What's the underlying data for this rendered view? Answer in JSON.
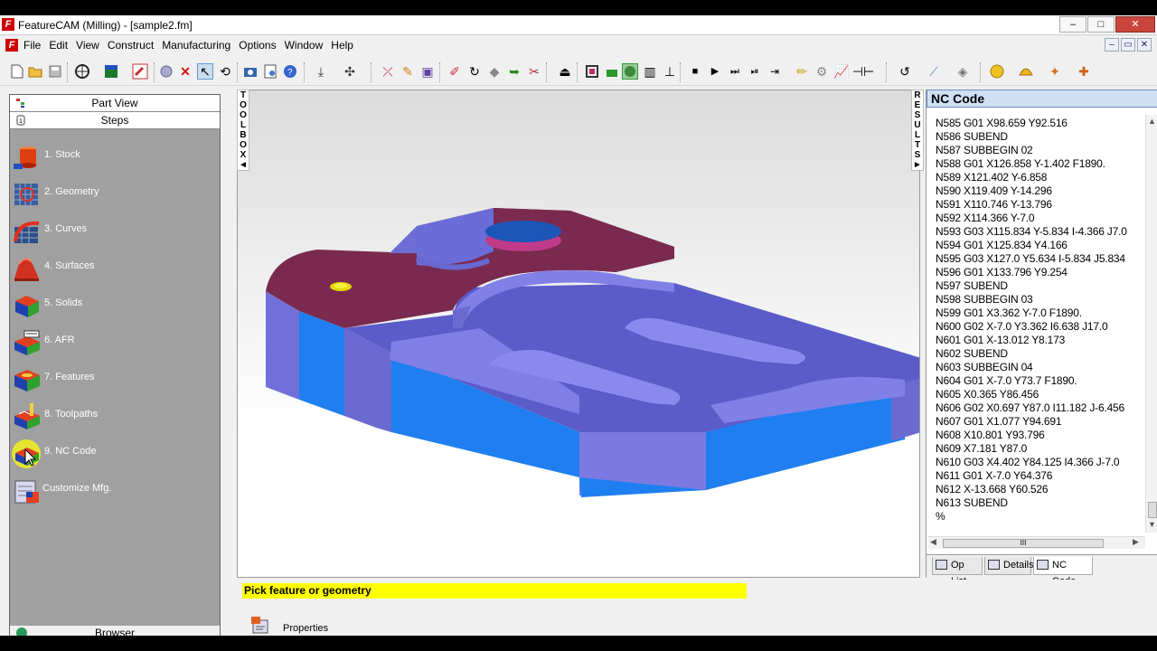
{
  "window": {
    "title": "FeatureCAM (Milling) - [sample2.fm]",
    "app_icon": "F",
    "buttons": [
      "–",
      "□",
      "✕"
    ]
  },
  "menu": {
    "items": [
      "File",
      "Edit",
      "View",
      "Construct",
      "Manufacturing",
      "Options",
      "Window",
      "Help"
    ],
    "mdi_buttons": [
      "–",
      "▭",
      "✕"
    ]
  },
  "left_panel": {
    "part_view": "Part View",
    "steps": "Steps",
    "items": [
      {
        "label": "1.  Stock",
        "icon": "stock-icon"
      },
      {
        "label": "2.  Geometry",
        "icon": "geometry-icon"
      },
      {
        "label": "3.  Curves",
        "icon": "curves-icon"
      },
      {
        "label": "4.  Surfaces",
        "icon": "surfaces-icon"
      },
      {
        "label": "5.  Solids",
        "icon": "solids-icon"
      },
      {
        "label": "6.  AFR",
        "icon": "afr-icon"
      },
      {
        "label": "7.  Features",
        "icon": "features-icon"
      },
      {
        "label": "8.  Toolpaths",
        "icon": "toolpaths-icon"
      },
      {
        "label": "9.  NC Code",
        "icon": "nc-code-icon"
      },
      {
        "label": "Customize Mfg.",
        "icon": "customize-mfg-icon"
      }
    ],
    "browser": "Browser"
  },
  "toolbox_label": [
    "T",
    "O",
    "O",
    "L",
    "B",
    "O",
    "X",
    "◄"
  ],
  "results_label": [
    "R",
    "E",
    "S",
    "U",
    "L",
    "T",
    "S",
    "►"
  ],
  "nc_panel": {
    "title": "NC Code",
    "lines": [
      "N585 G01 X98.659 Y92.516",
      "N586 SUBEND",
      "N587 SUBBEGIN 02",
      "N588 G01 X126.858 Y-1.402 F1890.",
      "N589 X121.402 Y-6.858",
      "N590 X119.409 Y-14.296",
      "N591 X110.746 Y-13.796",
      "N592 X114.366 Y-7.0",
      "N593 G03 X115.834 Y-5.834 I-4.366 J7.0",
      "N594 G01 X125.834 Y4.166",
      "N595 G03 X127.0 Y5.634 I-5.834 J5.834",
      "N596 G01 X133.796 Y9.254",
      "N597 SUBEND",
      "N598 SUBBEGIN 03",
      "N599 G01 X3.362 Y-7.0 F1890.",
      "N600 G02 X-7.0 Y3.362 I6.638 J17.0",
      "N601 G01 X-13.012 Y8.173",
      "N602 SUBEND",
      "N603 SUBBEGIN 04",
      "N604 G01 X-7.0 Y73.7 F1890.",
      "N605 X0.365 Y86.456",
      "N606 G02 X0.697 Y87.0 I11.182 J-6.456",
      "N607 G01 X1.077 Y94.691",
      "N608 X10.801 Y93.796",
      "N609 X7.181 Y87.0",
      "N610 G03 X4.402 Y84.125 I4.366 J-7.0",
      "N611 G01 X-7.0 Y64.376",
      "N612 X-13.668 Y60.526",
      "N613 SUBEND",
      "%"
    ],
    "scroll_grip": "III",
    "tabs": [
      "Op List",
      "Details",
      "NC Code"
    ]
  },
  "status": {
    "message": "Pick feature or geometry",
    "properties": "Properties"
  },
  "colors": {
    "part_top": "#7a2a4f",
    "part_pocket": "#5b5bc9",
    "part_side": "#1f7ff0",
    "status_highlight": "#ffff00",
    "panel_gray": "#a0a0a0"
  }
}
